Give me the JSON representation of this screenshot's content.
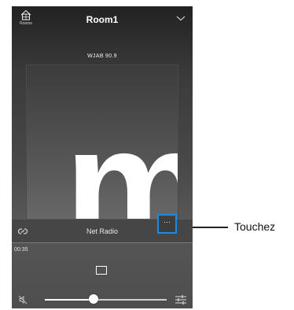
{
  "header": {
    "rooms_label": "Rooms",
    "room_name": "Room1"
  },
  "now_playing": {
    "station": "WJAB 90.9",
    "artwork_letter": "m",
    "source": "Net Radio",
    "elapsed": "00:35",
    "more_label": "···"
  },
  "volume": {
    "level": 0.4
  },
  "callout": {
    "label": "Touchez"
  },
  "colors": {
    "highlight": "#1e8be0"
  }
}
